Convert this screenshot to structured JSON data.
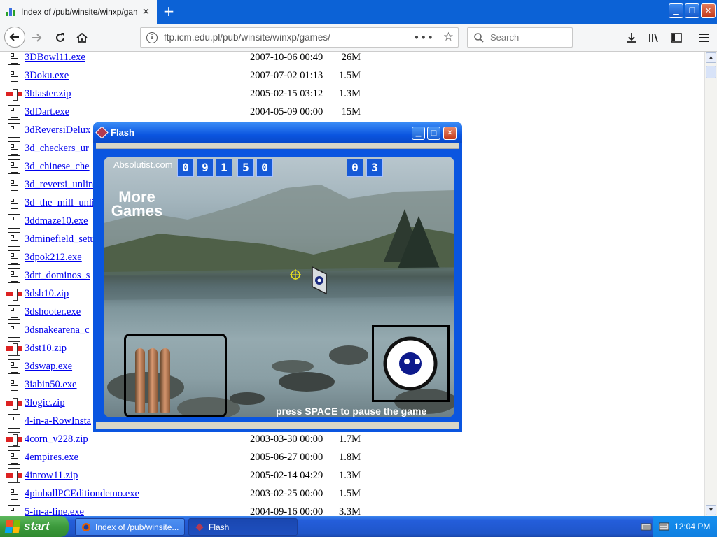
{
  "browser": {
    "tab_title": "Index of /pub/winsite/winxp/games/",
    "url": "ftp.icm.edu.pl/pub/winsite/winxp/games/",
    "search_placeholder": "Search",
    "new_tab_label": "+",
    "tab_close_label": "✕"
  },
  "files": [
    {
      "name": "3DBowl11.exe",
      "type": "exe",
      "date": "2007-10-06 00:49",
      "size": "26M"
    },
    {
      "name": "3Doku.exe",
      "type": "exe",
      "date": "2007-07-02 01:13",
      "size": "1.5M"
    },
    {
      "name": "3blaster.zip",
      "type": "zip",
      "date": "2005-02-15 03:12",
      "size": "1.3M"
    },
    {
      "name": "3dDart.exe",
      "type": "exe",
      "date": "2004-05-09 00:00",
      "size": "15M"
    },
    {
      "name": "3dReversiDelux",
      "type": "exe",
      "date": "",
      "size": ""
    },
    {
      "name": "3d_checkers_ur",
      "type": "exe",
      "date": "",
      "size": ""
    },
    {
      "name": "3d_chinese_che",
      "type": "exe",
      "date": "",
      "size": ""
    },
    {
      "name": "3d_reversi_unlin",
      "type": "exe",
      "date": "",
      "size": ""
    },
    {
      "name": "3d_the_mill_unli",
      "type": "exe",
      "date": "",
      "size": ""
    },
    {
      "name": "3ddmaze10.exe",
      "type": "exe",
      "date": "",
      "size": ""
    },
    {
      "name": "3dminefield_setu",
      "type": "exe",
      "date": "",
      "size": ""
    },
    {
      "name": "3dpok212.exe",
      "type": "exe",
      "date": "",
      "size": ""
    },
    {
      "name": "3drt_dominos_s",
      "type": "exe",
      "date": "",
      "size": ""
    },
    {
      "name": "3dsb10.zip",
      "type": "zip",
      "date": "",
      "size": ""
    },
    {
      "name": "3dshooter.exe",
      "type": "exe",
      "date": "",
      "size": ""
    },
    {
      "name": "3dsnakearena_c",
      "type": "exe",
      "date": "",
      "size": ""
    },
    {
      "name": "3dst10.zip",
      "type": "zip",
      "date": "",
      "size": ""
    },
    {
      "name": "3dswap.exe",
      "type": "exe",
      "date": "",
      "size": ""
    },
    {
      "name": "3iabin50.exe",
      "type": "exe",
      "date": "",
      "size": ""
    },
    {
      "name": "3logic.zip",
      "type": "zip",
      "date": "",
      "size": ""
    },
    {
      "name": "4-in-a-RowInsta",
      "type": "exe",
      "date": "",
      "size": ""
    },
    {
      "name": "4corn_v228.zip",
      "type": "zip",
      "date": "2003-03-30 00:00",
      "size": "1.7M"
    },
    {
      "name": "4empires.exe",
      "type": "exe",
      "date": "2005-06-27 00:00",
      "size": "1.8M"
    },
    {
      "name": "4inrow11.zip",
      "type": "zip",
      "date": "2005-02-14 04:29",
      "size": "1.3M"
    },
    {
      "name": "4pinballPCEditiondemo.exe",
      "type": "exe",
      "date": "2003-02-25 00:00",
      "size": "1.5M"
    },
    {
      "name": "5-in-a-line.exe",
      "type": "exe",
      "date": "2004-09-16 00:00",
      "size": "3.3M"
    }
  ],
  "flash_window": {
    "title": "Flash",
    "brand": "Absolutist.com",
    "more_games": "More Games",
    "score_digits": [
      "0",
      "9",
      "1",
      "5",
      "0"
    ],
    "level_digits": [
      "0",
      "3"
    ],
    "pause_hint": "press SPACE to pause the game",
    "ammo_count": 3
  },
  "taskbar": {
    "start_label": "start",
    "tasks": [
      {
        "label": "Index of /pub/winsite..."
      },
      {
        "label": "Flash"
      }
    ],
    "clock": "12:04 PM"
  },
  "colors": {
    "link": "#0000ee",
    "titlebar_blue": "#0a55e0",
    "taskbar_blue": "#245edb",
    "start_green": "#3c9a3c"
  }
}
